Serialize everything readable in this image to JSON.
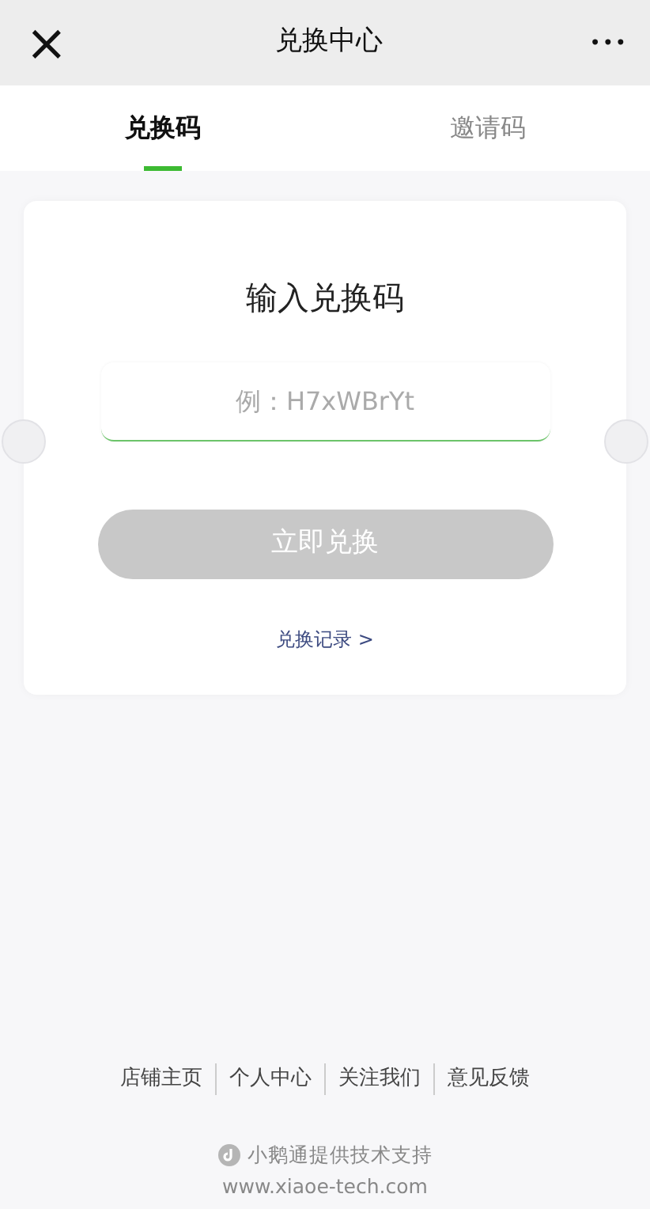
{
  "title_bar": {
    "close": "×",
    "title": "兑换中心",
    "more": "•••"
  },
  "tabs": [
    {
      "label": "兑换码",
      "selected": true
    },
    {
      "label": "邀请码",
      "selected": false
    }
  ],
  "card": {
    "heading": "输入兑换码",
    "field": {
      "placeholder": "例：H7xWBrYt"
    },
    "button": {
      "label": "立即兑换",
      "disabled": true
    },
    "record_link": "兑换记录 >"
  },
  "footer_links": [
    "店铺主页",
    "个人中心",
    "关注我们",
    "意见反馈"
  ],
  "support": "小鹅通提供技术支持",
  "website": "www.xiaoe-tech.com"
}
